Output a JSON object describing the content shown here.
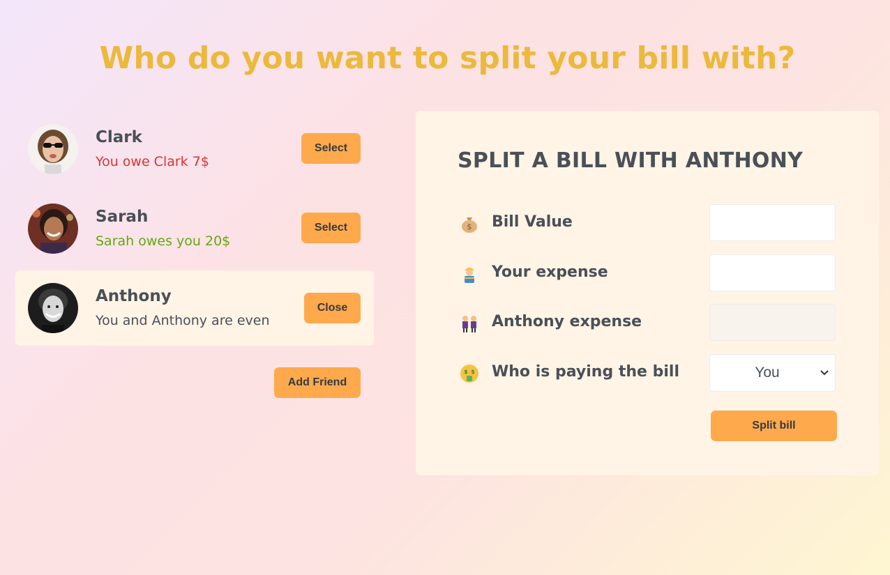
{
  "header": {
    "title": "Who do you want to split your bill with?"
  },
  "friends": [
    {
      "name": "Clark",
      "status": "You owe Clark 7$",
      "status_type": "negative",
      "button": "Select",
      "selected": false
    },
    {
      "name": "Sarah",
      "status": "Sarah owes you 20$",
      "status_type": "positive",
      "button": "Select",
      "selected": false
    },
    {
      "name": "Anthony",
      "status": "You and Anthony are even",
      "status_type": "even",
      "button": "Close",
      "selected": true
    }
  ],
  "add_friend_label": "Add Friend",
  "split_form": {
    "title": "Split a bill with Anthony",
    "bill_value": {
      "label": "Bill Value",
      "value": "",
      "icon": "money-bag-icon"
    },
    "your_expense": {
      "label": "Your expense",
      "value": "",
      "icon": "construction-worker-icon"
    },
    "friend_expense": {
      "label": "Anthony expense",
      "value": "",
      "icon": "people-icon"
    },
    "payer": {
      "label": "Who is paying the bill",
      "selected": "You",
      "icon": "money-mouth-face-icon"
    },
    "submit_label": "Split bill"
  },
  "colors": {
    "accent": "#ffa94d",
    "title": "#ebb93b",
    "negative": "#e03131",
    "positive": "#66a80f",
    "panel_bg": "#fff4e6",
    "text": "#495057"
  }
}
